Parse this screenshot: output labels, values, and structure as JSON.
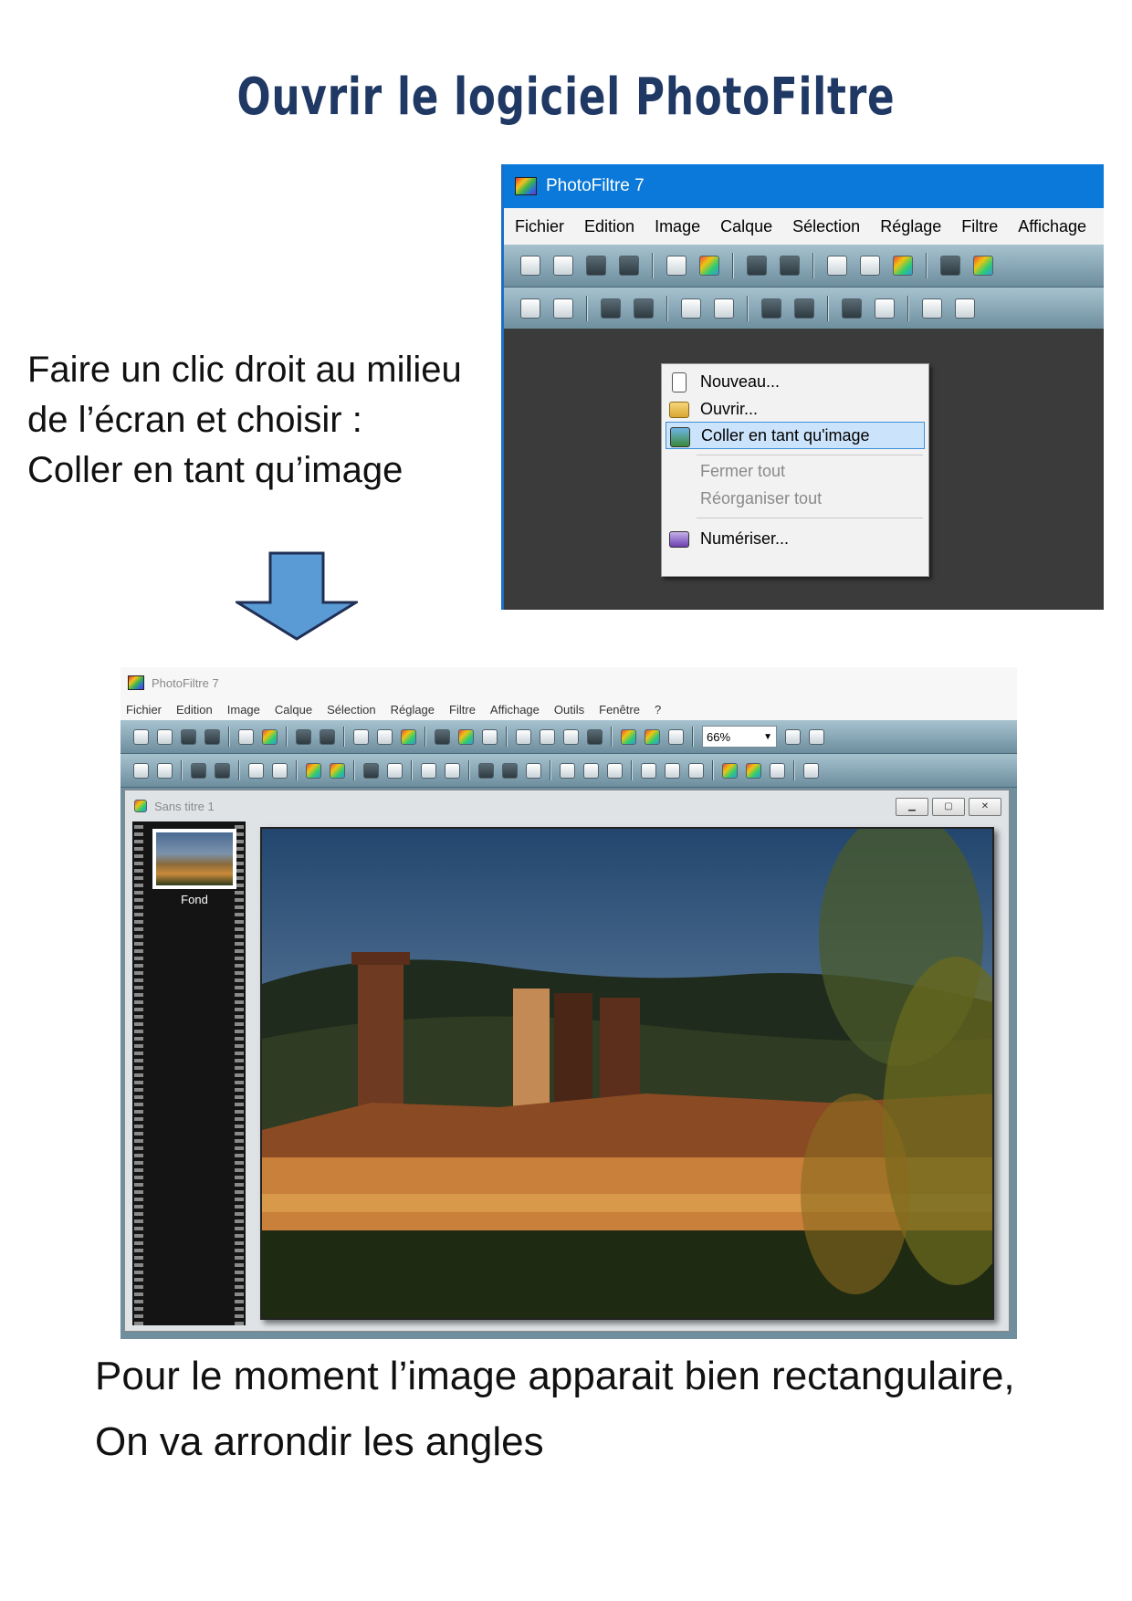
{
  "page": {
    "title": "Ouvrir le logiciel PhotoFiltre",
    "instructions": [
      "Faire un clic droit au milieu",
      "de l’écran et choisir :",
      "Coller en tant qu’image"
    ],
    "caption": [
      "Pour le moment l’image apparait bien rectangulaire,",
      "On va arrondir les angles"
    ]
  },
  "shot1": {
    "window_title": "PhotoFiltre 7",
    "menu": [
      "Fichier",
      "Edition",
      "Image",
      "Calque",
      "Sélection",
      "Réglage",
      "Filtre",
      "Affichage"
    ],
    "context_menu": {
      "items": [
        {
          "label": "Nouveau...",
          "icon": "new-document-icon",
          "state": "normal"
        },
        {
          "label": "Ouvrir...",
          "icon": "open-folder-icon",
          "state": "normal"
        },
        {
          "label": "Coller en tant qu'image",
          "icon": "paste-image-icon",
          "state": "highlighted"
        },
        {
          "label": "Fermer tout",
          "icon": "",
          "state": "disabled"
        },
        {
          "label": "Réorganiser tout",
          "icon": "",
          "state": "disabled"
        },
        {
          "label": "Numériser...",
          "icon": "scanner-icon",
          "state": "normal"
        }
      ]
    }
  },
  "shot2": {
    "window_title": "PhotoFiltre 7",
    "menu": [
      "Fichier",
      "Edition",
      "Image",
      "Calque",
      "Sélection",
      "Réglage",
      "Filtre",
      "Affichage",
      "Outils",
      "Fenêtre",
      "?"
    ],
    "zoom": "66%",
    "document": {
      "title": "Sans titre 1",
      "layer_label": "Fond"
    }
  },
  "colors": {
    "title": "#1f3864",
    "titlebar_blue": "#0a79d9",
    "toolbar": "#8aa9b7",
    "highlight": "#cce4fb",
    "arrow": "#5b9bd5"
  }
}
